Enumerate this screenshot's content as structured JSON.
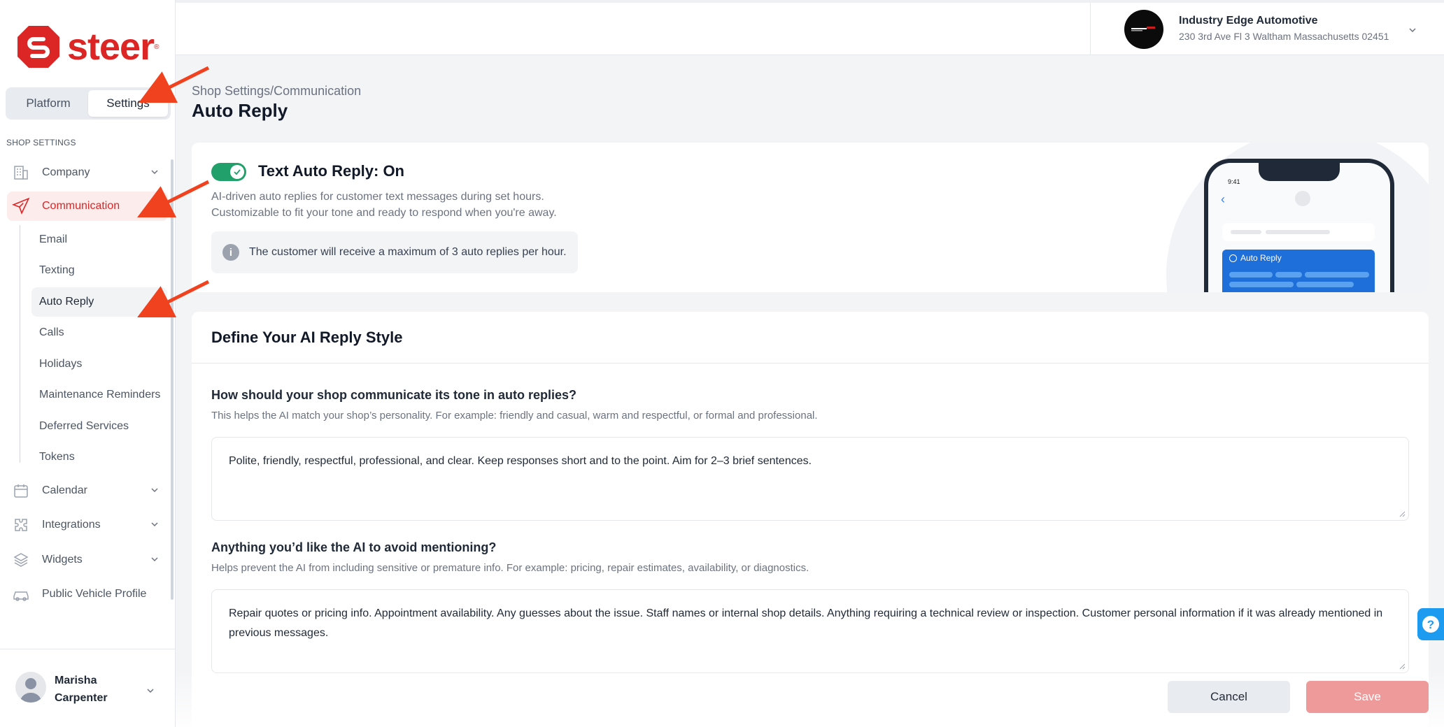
{
  "brand": {
    "name": "steer",
    "registered": "®",
    "color": "#dc2626"
  },
  "segment": {
    "platform": "Platform",
    "settings": "Settings"
  },
  "sidebar": {
    "section_title": "SHOP SETTINGS",
    "items": [
      {
        "label": "Company",
        "icon": "building-icon"
      },
      {
        "label": "Communication",
        "icon": "paper-plane-icon"
      },
      {
        "label": "Calendar",
        "icon": "calendar-icon"
      },
      {
        "label": "Integrations",
        "icon": "puzzle-icon"
      },
      {
        "label": "Widgets",
        "icon": "layers-icon"
      },
      {
        "label": "Public Vehicle Profile",
        "icon": "car-icon"
      }
    ],
    "sub_items": [
      "Email",
      "Texting",
      "Auto Reply",
      "Calls",
      "Holidays",
      "Maintenance Reminders",
      "Deferred Services",
      "Tokens"
    ]
  },
  "user": {
    "name": "Marisha Carpenter"
  },
  "shop": {
    "name": "Industry Edge Automotive",
    "address": "230 3rd Ave Fl 3 Waltham Massachusetts 02451"
  },
  "breadcrumb": {
    "parent": "Shop Settings",
    "separator": "/",
    "current": "Communication"
  },
  "page_title": "Auto Reply",
  "auto_reply": {
    "title": "Text Auto Reply: On",
    "enabled": true,
    "desc_line1": "AI-driven auto replies for customer text messages during set hours.",
    "desc_line2": "Customizable to fit your tone and ready to respond when you're away.",
    "info": "The customer will receive a maximum of 3 auto replies per hour.",
    "phone_time": "9:41",
    "phone_label": "Auto Reply"
  },
  "style_card": {
    "title": "Define Your AI Reply Style",
    "q1": {
      "title": "How should your shop communicate its tone in auto replies?",
      "help": "This helps the AI match your shop’s personality. For example: friendly and casual, warm and respectful, or formal and professional.",
      "value": "Polite, friendly, respectful, professional, and clear. Keep responses short and to the point. Aim for 2–3 brief sentences."
    },
    "q2": {
      "title": "Anything you’d like the AI to avoid mentioning?",
      "help": "Helps prevent the AI from including sensitive or premature info. For example: pricing, repair estimates, availability, or diagnostics.",
      "value": "Repair quotes or pricing info. Appointment availability. Any guesses about the issue. Staff names or internal shop details. Anything requiring a technical review or inspection. Customer personal information if it was already mentioned in previous messages."
    }
  },
  "actions": {
    "cancel": "Cancel",
    "save": "Save"
  },
  "colors": {
    "accent": "#dc2626",
    "toggle_on": "#22a06b",
    "save_disabled": "#ef9a9a",
    "annotation_arrow": "#f0421f"
  }
}
